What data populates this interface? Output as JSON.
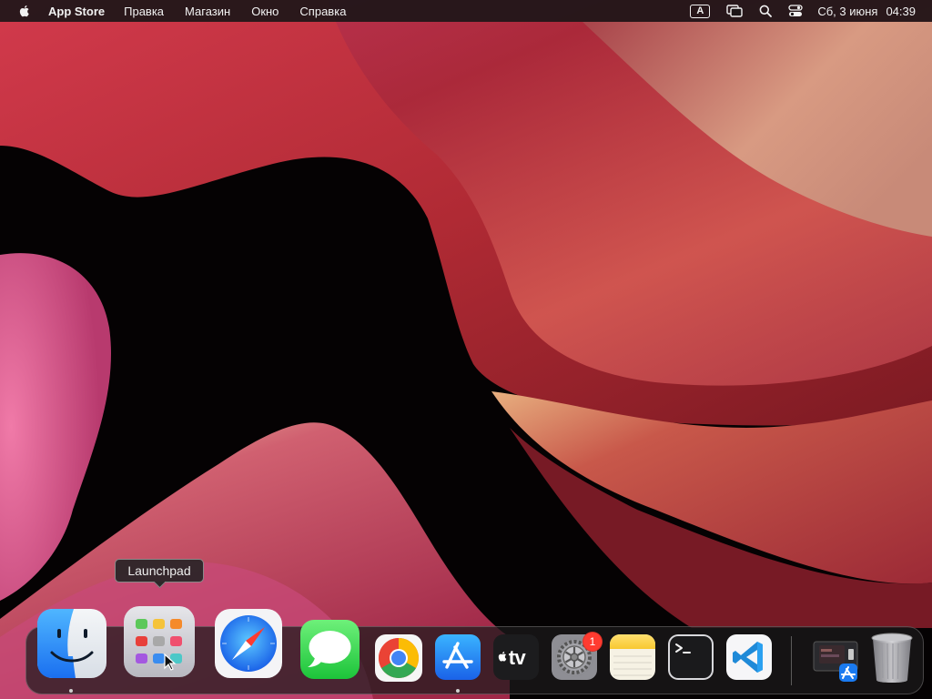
{
  "menubar": {
    "app_name": "App Store",
    "items": [
      "Правка",
      "Магазин",
      "Окно",
      "Справка"
    ],
    "input_source": "A",
    "date": "Сб, 3 июня",
    "time": "04:39"
  },
  "tooltip": {
    "label": "Launchpad"
  },
  "dock": {
    "apps": [
      {
        "name": "Finder",
        "icon": "finder-icon",
        "running": true
      },
      {
        "name": "Launchpad",
        "icon": "launchpad-icon",
        "running": false
      },
      {
        "name": "Safari",
        "icon": "safari-icon",
        "running": false
      },
      {
        "name": "Messages",
        "icon": "messages-icon",
        "running": false
      },
      {
        "name": "Google Chrome",
        "icon": "chrome-icon",
        "running": false
      },
      {
        "name": "App Store",
        "icon": "app-store-icon",
        "running": true
      },
      {
        "name": "Apple TV",
        "icon": "apple-tv-icon",
        "running": false
      },
      {
        "name": "System Preferences",
        "icon": "system-preferences-icon",
        "running": false
      },
      {
        "name": "Notes",
        "icon": "notes-icon",
        "running": false
      },
      {
        "name": "Terminal",
        "icon": "terminal-icon",
        "running": false
      },
      {
        "name": "Visual Studio Code",
        "icon": "vscode-icon",
        "running": false
      },
      {
        "name": "Downloads",
        "icon": "downloads-stack-icon",
        "running": false
      },
      {
        "name": "Trash",
        "icon": "trash-icon",
        "running": false
      }
    ],
    "settings_badge": "1",
    "tv_label": "tv"
  },
  "colors": {
    "menubar_bg": "#1c1618",
    "dock_bg": "#1c1a1c",
    "badge": "#ff3b30"
  }
}
